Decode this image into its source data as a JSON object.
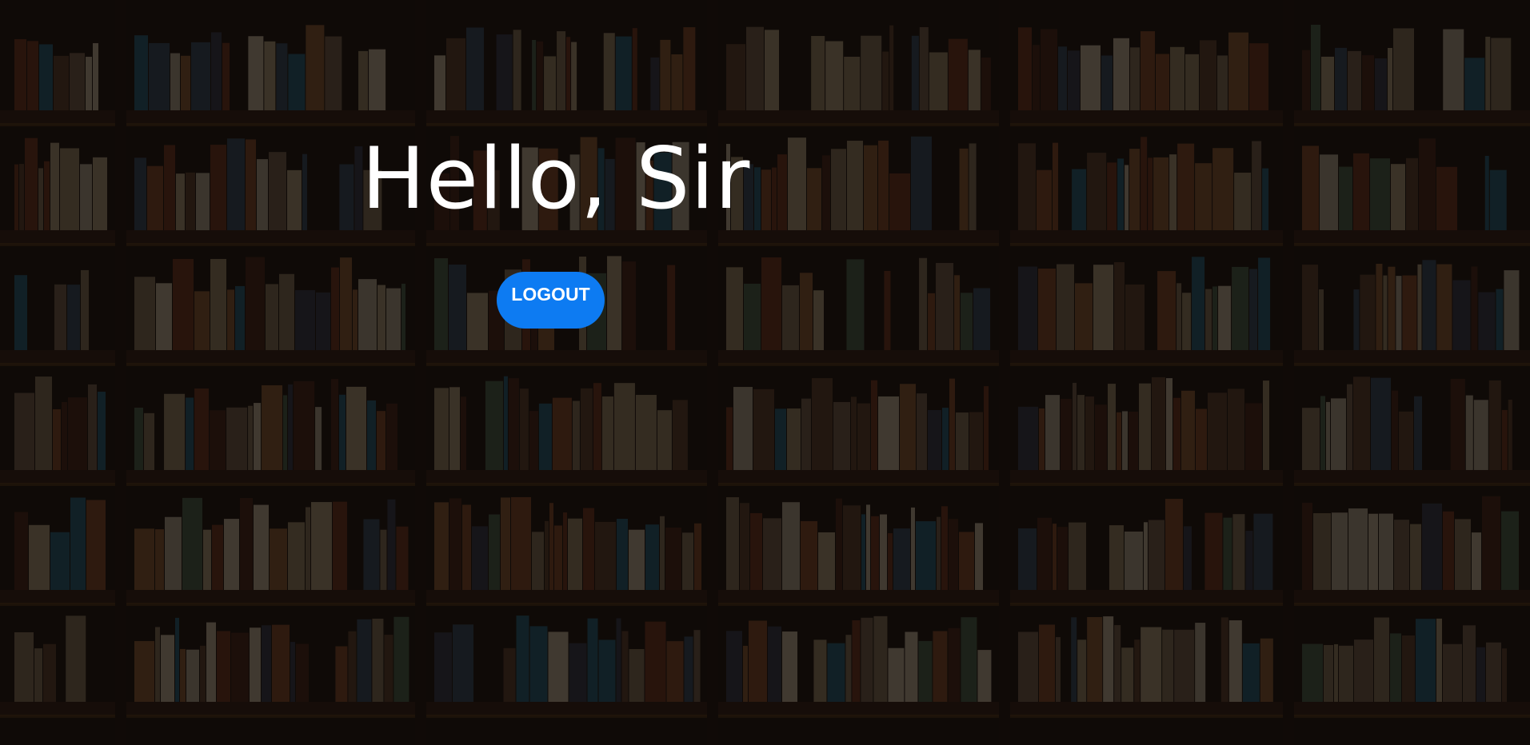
{
  "page": {
    "greeting": "Hello, Sir",
    "logout_label": "LOGOUT"
  },
  "colors": {
    "overlay": "#120d0a",
    "button": "#0d7bf2",
    "text": "#ffffff"
  },
  "background": {
    "subject": "bookshelf-photo"
  }
}
